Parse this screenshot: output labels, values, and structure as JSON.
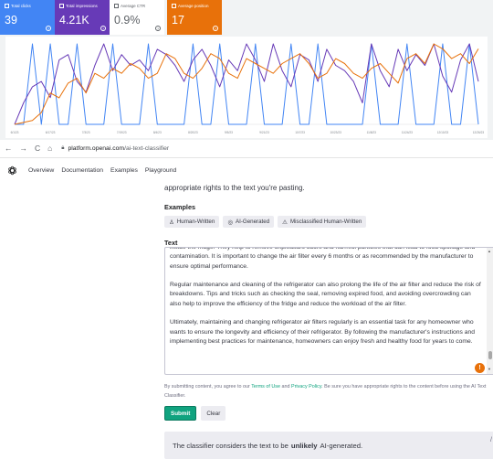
{
  "search_console": {
    "cards": [
      {
        "label": "Total clicks",
        "value": "39"
      },
      {
        "label": "Total impressions",
        "value": "4.21K"
      },
      {
        "label": "Average CTR",
        "value": "0.9%"
      },
      {
        "label": "Average position",
        "value": "17"
      }
    ],
    "colors": {
      "clicks": "#4285f4",
      "impressions": "#673ab7",
      "ctr": "#ffffff",
      "position": "#e8710a"
    }
  },
  "chart_data": {
    "type": "line",
    "x": [
      "6/1/23",
      "6/5/23",
      "6/9/23",
      "6/13/23",
      "6/17/23",
      "6/21/23",
      "6/25/23",
      "6/29/23",
      "7/3/23",
      "7/7/23",
      "7/11/23",
      "7/15/23",
      "7/19/23",
      "7/23/23",
      "7/27/23",
      "7/31/23",
      "8/4/23",
      "8/8/23",
      "8/12/23",
      "8/16/23",
      "8/20/23",
      "8/24/23",
      "8/28/23",
      "9/1/23",
      "9/5/23",
      "9/9/23",
      "9/13/23",
      "9/17/23",
      "9/21/23",
      "9/25/23",
      "9/29/23",
      "10/3/23",
      "10/7/23",
      "10/11/23",
      "10/15/23",
      "10/19/23",
      "10/23/23",
      "10/27/23",
      "10/31/23",
      "11/4/23",
      "11/8/23",
      "11/12/23",
      "11/16/23",
      "11/20/23",
      "11/24/23",
      "11/28/23",
      "12/2/23",
      "12/6/23",
      "12/10/23",
      "12/14/23",
      "12/18/23",
      "12/22/23",
      "12/26/23"
    ],
    "series": [
      {
        "name": "Total clicks",
        "color": "#4285f4",
        "values": [
          0,
          0,
          2,
          0,
          2,
          0,
          0,
          2,
          0,
          0,
          0,
          2,
          0,
          0,
          0,
          2,
          0,
          0,
          0,
          0,
          2,
          0,
          0,
          2,
          0,
          0,
          0,
          2,
          0,
          0,
          0,
          2,
          0,
          0,
          2,
          0,
          0,
          0,
          0,
          0,
          2,
          0,
          0,
          0,
          2,
          0,
          0,
          0,
          2,
          0,
          0,
          2,
          0
        ]
      },
      {
        "name": "Total impressions",
        "color": "#673ab7",
        "values": [
          20,
          40,
          55,
          60,
          45,
          80,
          85,
          60,
          50,
          75,
          95,
          70,
          85,
          75,
          80,
          70,
          90,
          85,
          75,
          60,
          80,
          90,
          75,
          55,
          80,
          70,
          95,
          80,
          60,
          95,
          70,
          55,
          85,
          80,
          60,
          90,
          75,
          70,
          60,
          40,
          95,
          70,
          55,
          90,
          70,
          85,
          75,
          95,
          65,
          50,
          80,
          95,
          60
        ]
      },
      {
        "name": "Average position",
        "color": "#e8710a",
        "values": [
          8,
          10,
          12,
          20,
          40,
          35,
          50,
          55,
          40,
          60,
          55,
          65,
          60,
          70,
          65,
          55,
          60,
          80,
          75,
          60,
          55,
          65,
          80,
          75,
          60,
          55,
          75,
          70,
          65,
          60,
          70,
          75,
          80,
          70,
          55,
          60,
          75,
          70,
          60,
          55,
          65,
          70,
          60,
          50,
          75,
          80,
          70,
          90,
          85,
          75,
          80,
          70,
          85
        ]
      }
    ]
  },
  "browser": {
    "back": "←",
    "forward": "→",
    "reload": "C",
    "home": "⌂",
    "url_host": "platform.openai.com",
    "url_path": "/ai-text-classifier"
  },
  "header": {
    "nav": [
      "Overview",
      "Documentation",
      "Examples",
      "Playground"
    ]
  },
  "main": {
    "truncated_line": "appropriate rights to the text you're pasting.",
    "examples_heading": "Examples",
    "examples": [
      {
        "icon": "person-icon",
        "glyph": "♙",
        "label": "Human-Written"
      },
      {
        "icon": "ai-icon",
        "glyph": "◎",
        "label": "AI-Generated"
      },
      {
        "icon": "warning-icon",
        "glyph": "⚠",
        "label": "Misclassified Human-Written"
      }
    ],
    "text_heading": "Text",
    "text_paragraphs": [
      "inside the fridge. They help to remove unpleasant odors and harmful particles that can lead to food spoilage and contamination. It is important to change the air filter every 6 months or as recommended by the manufacturer to ensure optimal performance.",
      "Regular maintenance and cleaning of the refrigerator can also prolong the life of the air filter and reduce the risk of breakdowns. Tips and tricks such as checking the seal, removing expired food, and avoiding overcrowding can also help to improve the efficiency of the fridge and reduce the workload of the air filter.",
      "Ultimately, maintaining and changing refrigerator air filters regularly is an essential task for any homeowner who wants to ensure the longevity and efficiency of their refrigerator. By following the manufacturer's instructions and implementing best practices for maintenance, homeowners can enjoy fresh and healthy food for years to come."
    ],
    "consent_prefix": "By submitting content, you agree to our",
    "terms_link": "Terms of Use",
    "and": "and",
    "privacy_link": "Privacy Policy",
    "consent_suffix": ". Be sure you have appropriate rights to the content before using the AI Text Classifier.",
    "submit_label": "Submit",
    "clear_label": "Clear",
    "result_prefix": "The classifier considers the text to be",
    "result_value": "unlikely",
    "result_suffix": "AI-generated."
  }
}
